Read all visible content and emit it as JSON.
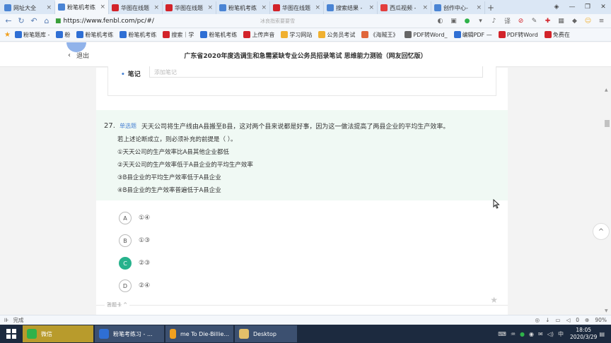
{
  "tabs": [
    {
      "label": "网址大全",
      "color": "#4a84d4"
    },
    {
      "label": "粉笔机考练",
      "color": "#4a84d4"
    },
    {
      "label": "华图在线题",
      "color": "#d2232a"
    },
    {
      "label": "华图在线题",
      "color": "#d2232a"
    },
    {
      "label": "粉笔机考练",
      "color": "#4a84d4"
    },
    {
      "label": "华图在线题",
      "color": "#d2232a"
    },
    {
      "label": "搜索结果 -",
      "color": "#4a84d4"
    },
    {
      "label": "西瓜视频 -",
      "color": "#e33e3e"
    },
    {
      "label": "创作中心-",
      "color": "#4a84d4"
    }
  ],
  "address": {
    "url": "https://www.fenbl.com/pc/#/",
    "search_placeholder": "冰良指索要要雪",
    "back": "←",
    "forward": "→",
    "refresh": "↻",
    "home": "⌂",
    "history": "↶",
    "lock": "🔒"
  },
  "bookmarks": [
    {
      "label": "粉笔题库 -",
      "color": "#2f6fd4"
    },
    {
      "label": "粉",
      "color": "#2f6fd4"
    },
    {
      "label": "粉笔机考练",
      "color": "#2f6fd4"
    },
    {
      "label": "粉笔机考练",
      "color": "#2f6fd4"
    },
    {
      "label": "搜索｜学",
      "color": "#d2232a"
    },
    {
      "label": "粉笔机考练",
      "color": "#2f6fd4"
    },
    {
      "label": "上传声音",
      "color": "#d2232a"
    },
    {
      "label": "学习网站",
      "color": "#f0b030"
    },
    {
      "label": "公务员考试",
      "color": "#f0b030"
    },
    {
      "label": "《海贼王》",
      "color": "#e0663a"
    },
    {
      "label": "PDF转Word_",
      "color": "#666666"
    },
    {
      "label": "编辑PDF —",
      "color": "#2f6fd4"
    },
    {
      "label": "PDF转Word",
      "color": "#d2232a"
    },
    {
      "label": "免费在",
      "color": "#d2232a"
    }
  ],
  "page": {
    "back_label": "退出",
    "title": "广东省2020年度选调生和急需紧缺专业公务员招录笔试 思维能力测验（网友回忆版）",
    "note_label": "笔记",
    "note_placeholder": "添加笔记",
    "question": {
      "number": "27.",
      "type": "单选题",
      "stem": "天天公司将生产线由A县搬至B县，这对两个县来说都是好事，因为这一做法提高了两县企业的平均生产效率。",
      "lines": [
        "若上述论断成立，则必须补充的前提是（    ）。",
        "①天天公司的生产效率比A县其他企业都低",
        "②天天公司的生产效率低于A县企业的平均生产效率",
        "③B县企业的平均生产效率低于A县企业",
        "④B县企业的生产效率普遍低于A县企业"
      ]
    },
    "options": [
      {
        "letter": "A",
        "text": "①④",
        "correct": false
      },
      {
        "letter": "B",
        "text": "①③",
        "correct": false
      },
      {
        "letter": "C",
        "text": "②③",
        "correct": true
      },
      {
        "letter": "D",
        "text": "②④",
        "correct": false
      }
    ],
    "answer_card": "答题卡 ^",
    "to_top": "^"
  },
  "status": {
    "left": "完成",
    "zoom": "90%",
    "count": "0"
  },
  "taskbar": {
    "items": [
      {
        "label": "微信",
        "color": "#2fb24a"
      },
      {
        "label": "粉笔考练习 - ...",
        "color": "#2f6fd4"
      },
      {
        "label": "me To Die-Billie...",
        "color": "#f0a020"
      },
      {
        "label": "Desktop",
        "color": "#e3c06a"
      }
    ],
    "time": "18:05",
    "date": "2020/3/29"
  }
}
